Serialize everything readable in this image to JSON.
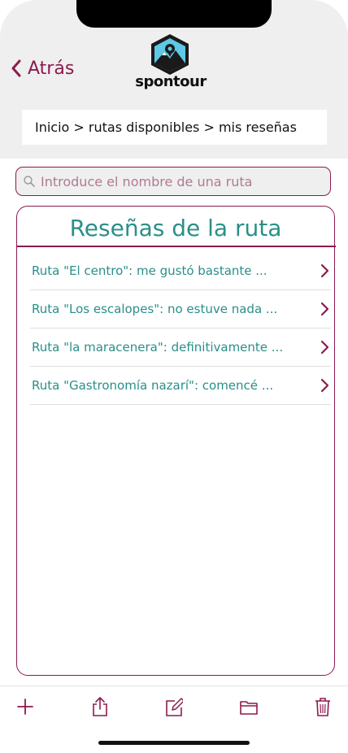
{
  "header": {
    "back_label": "Atrás",
    "logo_text": "spontour"
  },
  "breadcrumb": "Inicio > rutas disponibles > mis reseñas",
  "search": {
    "placeholder": "Introduce el nombre de una ruta"
  },
  "reviews": {
    "title": "Reseñas de la ruta",
    "items": [
      {
        "label": "Ruta \"El centro\": me gustó bastante ..."
      },
      {
        "label": "Ruta \"Los escalopes\": no estuve nada ..."
      },
      {
        "label": "Ruta \"la maracenera\": definitivamente ..."
      },
      {
        "label": "Ruta \"Gastronomía nazarí\": comencé ..."
      }
    ]
  },
  "toolbar": {
    "icons": [
      "add-icon",
      "share-icon",
      "edit-icon",
      "folder-icon",
      "trash-icon"
    ]
  },
  "colors": {
    "accent": "#8c1a4f",
    "teal": "#2a8f88",
    "header_bg": "#efefef"
  }
}
